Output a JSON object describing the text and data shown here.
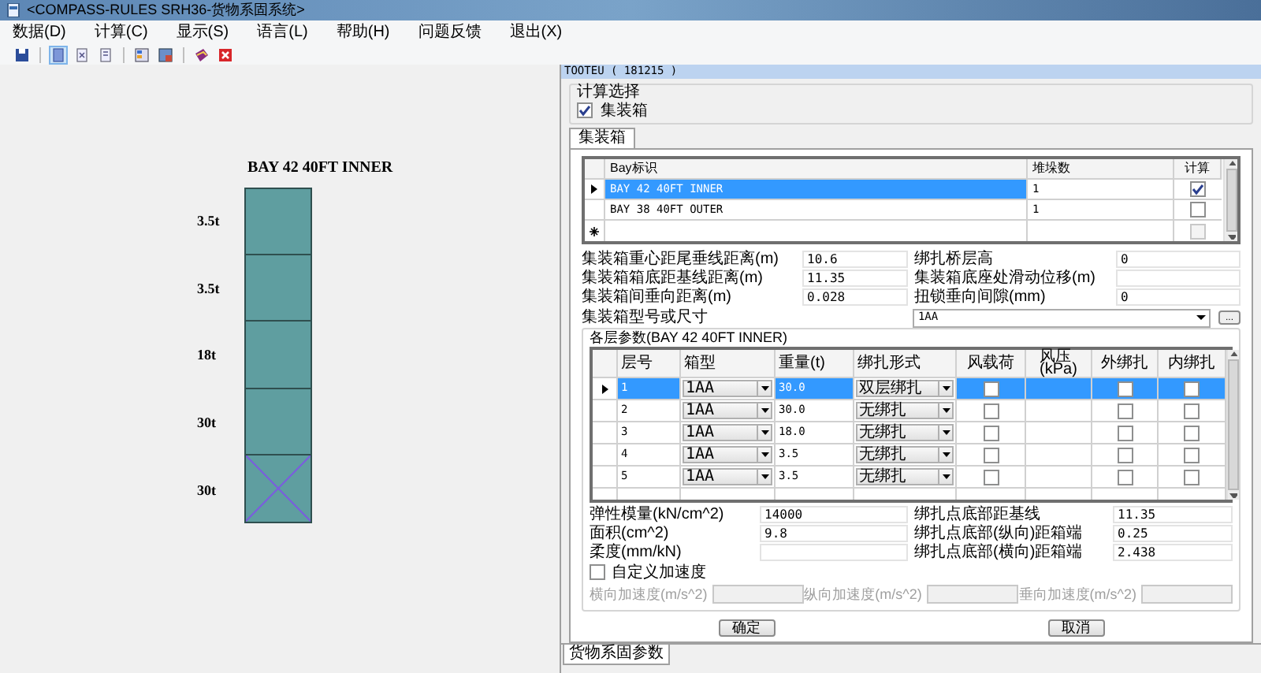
{
  "window": {
    "title": "<COMPASS-RULES SRH36-货物系固系统>"
  },
  "menu": [
    "数据(D)",
    "计算(C)",
    "显示(S)",
    "语言(L)",
    "帮助(H)",
    "问题反馈",
    "退出(X)"
  ],
  "toolbar": [
    {
      "selected": false
    },
    {
      "selected": true
    },
    {
      "selected": false
    },
    {
      "selected": false
    },
    {
      "selected": false
    },
    {
      "selected": false
    },
    {
      "selected": false
    },
    {
      "selected": false
    }
  ],
  "diagram": {
    "title": "BAY 42 40FT INNER",
    "tiers": [
      {
        "label": "3.5t",
        "marked": false
      },
      {
        "label": "3.5t",
        "marked": false
      },
      {
        "label": "18t",
        "marked": false
      },
      {
        "label": "30t",
        "marked": false
      },
      {
        "label": "30t",
        "marked": true
      }
    ]
  },
  "dialog": {
    "title": "TOOTEU ( 181215 )",
    "calc_group": {
      "legend": "计算选择",
      "option": {
        "label": "集装箱",
        "checked": true
      }
    },
    "tabs": [
      {
        "label": "集装箱",
        "selected": true
      }
    ],
    "bay_table": {
      "columns": [
        "Bay标识",
        "堆垛数",
        "计算"
      ],
      "rows": [
        {
          "bay": "BAY 42 40FT INNER",
          "count": "1",
          "calc": true,
          "selected": true
        },
        {
          "bay": "BAY 38 40FT OUTER",
          "count": "1",
          "calc": false,
          "selected": false
        }
      ],
      "new_row": {
        "calc": false
      }
    },
    "left_fields": [
      {
        "label": "集装箱重心距尾垂线距离(m)",
        "value": "10.6"
      },
      {
        "label": "集装箱箱底距基线距离(m)",
        "value": "11.35"
      },
      {
        "label": "集装箱间垂向距离(m)",
        "value": "0.028"
      }
    ],
    "right_fields": [
      {
        "label": "绑扎桥层高",
        "value": "0"
      },
      {
        "label": "集装箱底座处滑动位移(m)"
      },
      {
        "label": "扭锁垂向间隙(mm)",
        "value": "0"
      }
    ],
    "container_type": {
      "label": "集装箱型号或尺寸",
      "value": "1AA",
      "button": "..."
    },
    "layer_group": {
      "legend": "各层参数(BAY 42 40FT INNER)",
      "columns": [
        "层号",
        "箱型",
        "重量(t)",
        "绑扎形式",
        "风载荷",
        "风压\n(kPa)",
        "外绑扎",
        "内绑扎"
      ],
      "rows": [
        {
          "no": "1",
          "type": "1AA",
          "weight": "30.0",
          "lashing": "双层绑扎",
          "wind_load": false,
          "outer": false,
          "inner": false,
          "selected": true
        },
        {
          "no": "2",
          "type": "1AA",
          "weight": "30.0",
          "lashing": "无绑扎",
          "wind_load": false,
          "outer": false,
          "inner": false,
          "selected": false
        },
        {
          "no": "3",
          "type": "1AA",
          "weight": "18.0",
          "lashing": "无绑扎",
          "wind_load": false,
          "outer": false,
          "inner": false,
          "selected": false
        },
        {
          "no": "4",
          "type": "1AA",
          "weight": "3.5",
          "lashing": "无绑扎",
          "wind_load": false,
          "outer": false,
          "inner": false,
          "selected": false
        },
        {
          "no": "5",
          "type": "1AA",
          "weight": "3.5",
          "lashing": "无绑扎",
          "wind_load": false,
          "outer": false,
          "inner": false,
          "selected": false
        }
      ]
    },
    "bottom_left_fields": [
      {
        "label": "弹性模量(kN/cm^2)",
        "value": "14000"
      },
      {
        "label": "面积(cm^2)",
        "value": "9.8"
      },
      {
        "label": "柔度(mm/kN)"
      }
    ],
    "bottom_right_fields": [
      {
        "label": "绑扎点底部距基线",
        "value": "11.35"
      },
      {
        "label": "绑扎点底部(纵向)距箱端",
        "value": "0.25"
      },
      {
        "label": "绑扎点底部(横向)距箱端",
        "value": "2.438"
      }
    ],
    "custom_accel": {
      "label": "自定义加速度",
      "checked": false
    },
    "accel_fields": [
      {
        "label": "横向加速度(m/s^2)",
        "disabled": true
      },
      {
        "label": "纵向加速度(m/s^2)",
        "disabled": true
      },
      {
        "label": "垂向加速度(m/s^2)",
        "disabled": true
      }
    ],
    "buttons": [
      "确定",
      "取消"
    ]
  },
  "bottom_tabs": [
    {
      "label": "货物系固参数",
      "selected": true
    }
  ]
}
